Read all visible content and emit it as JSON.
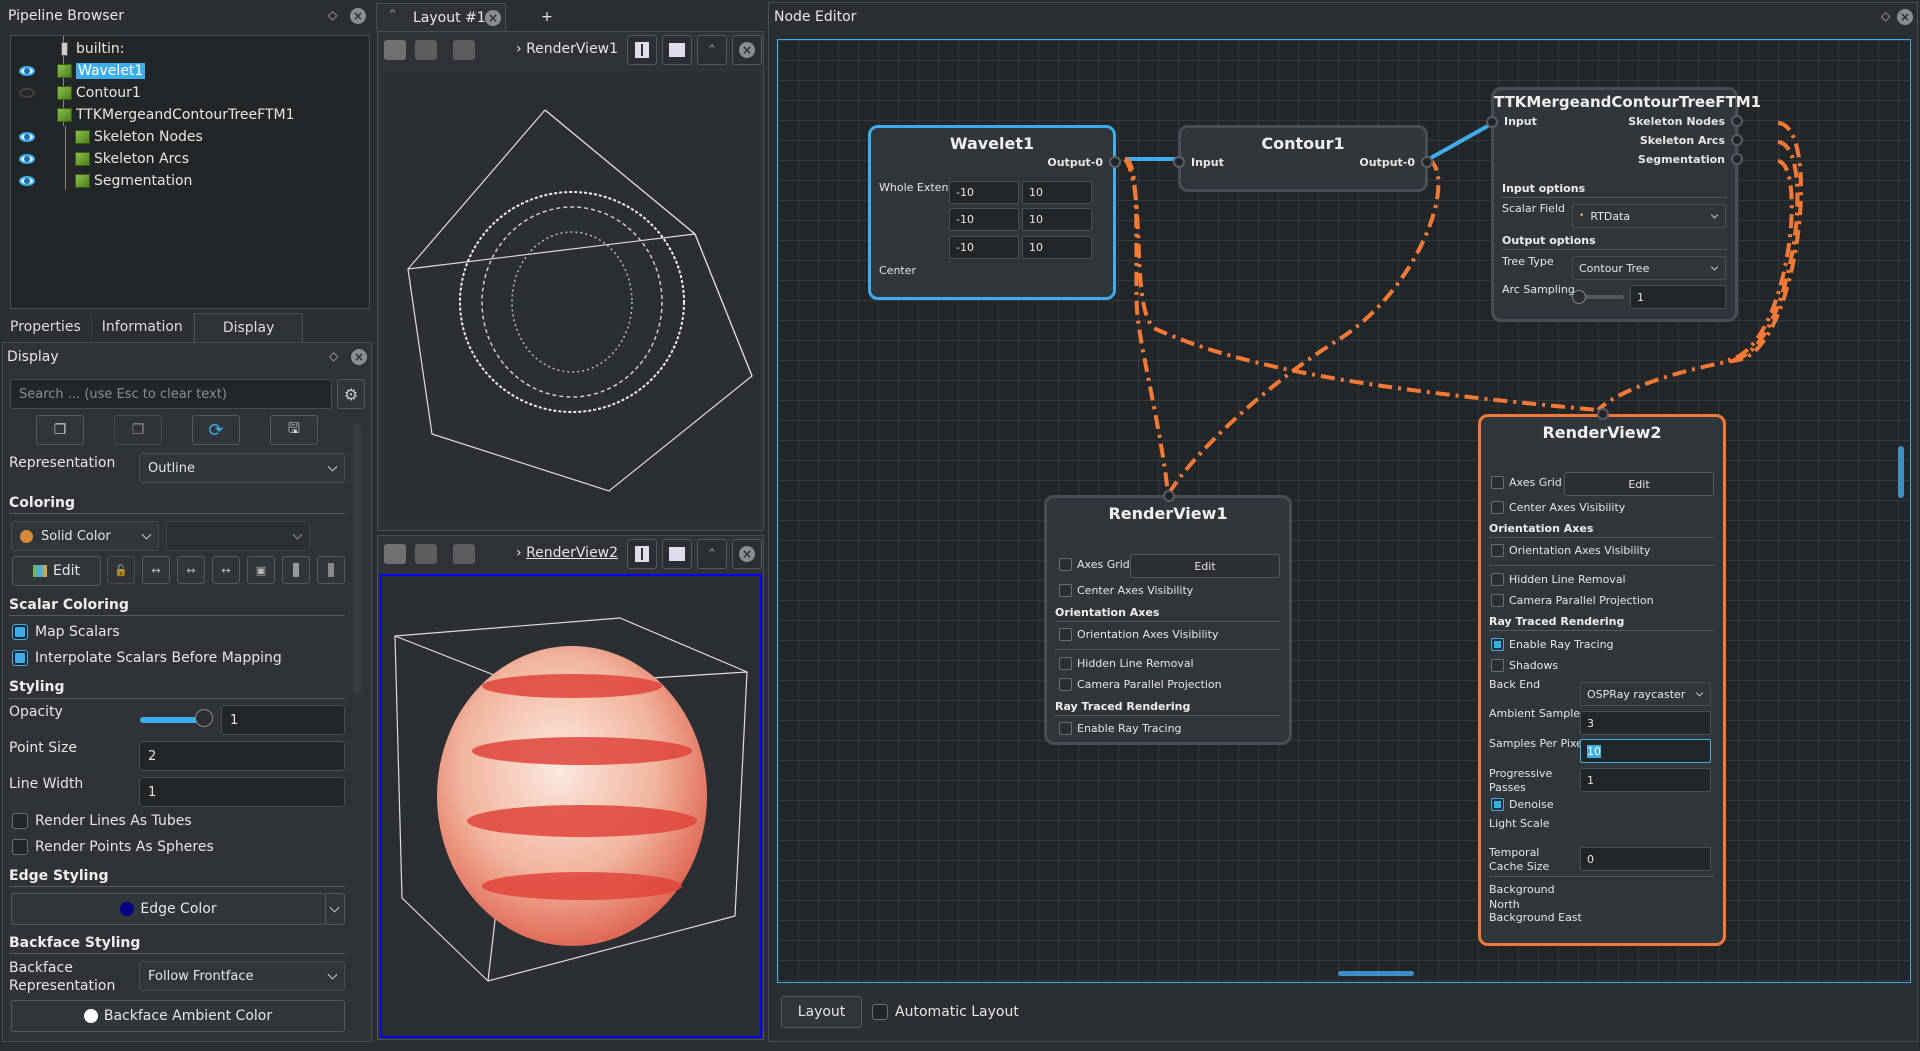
{
  "pipeline_browser": {
    "title": "Pipeline Browser",
    "items": [
      {
        "label": "builtin:",
        "icon": "server-icon",
        "visible": null
      },
      {
        "label": "Wavelet1",
        "icon": "source-cube-icon",
        "visible": true,
        "selected": true
      },
      {
        "label": "Contour1",
        "icon": "source-cube-icon",
        "visible": false
      },
      {
        "label": "TTKMergeandContourTreeFTM1",
        "icon": "source-cube-icon",
        "visible": null
      },
      {
        "label": "Skeleton Nodes",
        "icon": "source-cube-icon",
        "visible": true
      },
      {
        "label": "Skeleton Arcs",
        "icon": "source-cube-icon",
        "visible": true
      },
      {
        "label": "Segmentation",
        "icon": "source-cube-icon",
        "visible": true
      }
    ]
  },
  "panel_tabs": [
    {
      "label": "Properties",
      "active": false
    },
    {
      "label": "Information",
      "active": false
    },
    {
      "label": "Display",
      "active": true
    }
  ],
  "display": {
    "title": "Display",
    "search_placeholder": "Search ... (use Esc to clear text)",
    "representation_label": "Representation",
    "representation_value": "Outline",
    "coloring_section": "Coloring",
    "coloring_value": "Solid Color",
    "coloring_swatch": "#d9883a",
    "coloring_component": "",
    "edit_label": "Edit",
    "scalar_coloring_section": "Scalar Coloring",
    "map_scalars": {
      "label": "Map Scalars",
      "checked": true
    },
    "interpolate_scalars": {
      "label": "Interpolate Scalars Before Mapping",
      "checked": true
    },
    "styling_section": "Styling",
    "opacity_label": "Opacity",
    "opacity_value": "1",
    "opacity_fraction": 1.0,
    "point_size_label": "Point Size",
    "point_size_value": "2",
    "line_width_label": "Line Width",
    "line_width_value": "1",
    "render_lines_tubes": {
      "label": "Render Lines As Tubes",
      "checked": false
    },
    "render_points_spheres": {
      "label": "Render Points As Spheres",
      "checked": false
    },
    "edge_styling_section": "Edge Styling",
    "edge_color_label": "Edge Color",
    "edge_color_swatch": "#000080",
    "backface_section": "Backface Styling",
    "backface_rep_label": "Backface Representation",
    "backface_rep_value": "Follow Frontface",
    "backface_ambient_label": "Backface Ambient Color",
    "backface_ambient_swatch": "#ffffff"
  },
  "layout": {
    "tab_label": "Layout #1",
    "add_tab": "+",
    "view1_label": "RenderView1",
    "view2_label": "RenderView2"
  },
  "node_editor": {
    "title": "Node Editor",
    "layout_button": "Layout",
    "automatic_layout": {
      "label": "Automatic Layout",
      "checked": false
    },
    "wavelet": {
      "title": "Wavelet1",
      "output": "Output-0",
      "whole_extent_label": "Whole Extent",
      "extent": [
        [
          "-10",
          "10"
        ],
        [
          "-10",
          "10"
        ],
        [
          "-10",
          "10"
        ]
      ],
      "center_label": "Center"
    },
    "contour": {
      "title": "Contour1",
      "input": "Input",
      "output": "Output-0"
    },
    "ttk": {
      "title": "TTKMergeandContourTreeFTM1",
      "input": "Input",
      "outputs": [
        "Skeleton Nodes",
        "Skeleton Arcs",
        "Segmentation"
      ],
      "input_options": "Input options",
      "scalar_field_label": "Scalar Field",
      "scalar_field_value": "RTData",
      "output_options": "Output options",
      "tree_type_label": "Tree Type",
      "tree_type_value": "Contour Tree",
      "arc_sampling_label": "Arc Sampling",
      "arc_sampling_value": "1"
    },
    "renderview1": {
      "title": "RenderView1",
      "axes_grid": "Axes Grid",
      "edit": "Edit",
      "center_axes": "Center Axes Visibility",
      "orientation_section": "Orientation Axes",
      "orientation_vis": "Orientation Axes Visibility",
      "hidden_line": "Hidden Line Removal",
      "camera_parallel": "Camera Parallel Projection",
      "ray_section": "Ray Traced Rendering",
      "enable_ray": "Enable Ray Tracing"
    },
    "renderview2": {
      "title": "RenderView2",
      "axes_grid": "Axes Grid",
      "edit": "Edit",
      "center_axes": "Center Axes Visibility",
      "orientation_section": "Orientation Axes",
      "orientation_vis": "Orientation Axes Visibility",
      "hidden_line": "Hidden Line Removal",
      "camera_parallel": "Camera Parallel Projection",
      "ray_section": "Ray Traced Rendering",
      "enable_ray": "Enable Ray Tracing",
      "shadows": "Shadows",
      "back_end_label": "Back End",
      "back_end_value": "OSPRay raycaster",
      "ambient_samples_label": "Ambient Samples",
      "ambient_samples_value": "3",
      "samples_per_pixel_label": "Samples Per Pixel",
      "samples_per_pixel_value": "10",
      "progressive_label": "Progressive Passes",
      "progressive_value": "1",
      "denoise": "Denoise",
      "light_scale": "Light Scale",
      "temporal_label": "Temporal Cache Size",
      "temporal_value": "0",
      "bg_north": "Background North",
      "bg_east": "Background East"
    }
  }
}
